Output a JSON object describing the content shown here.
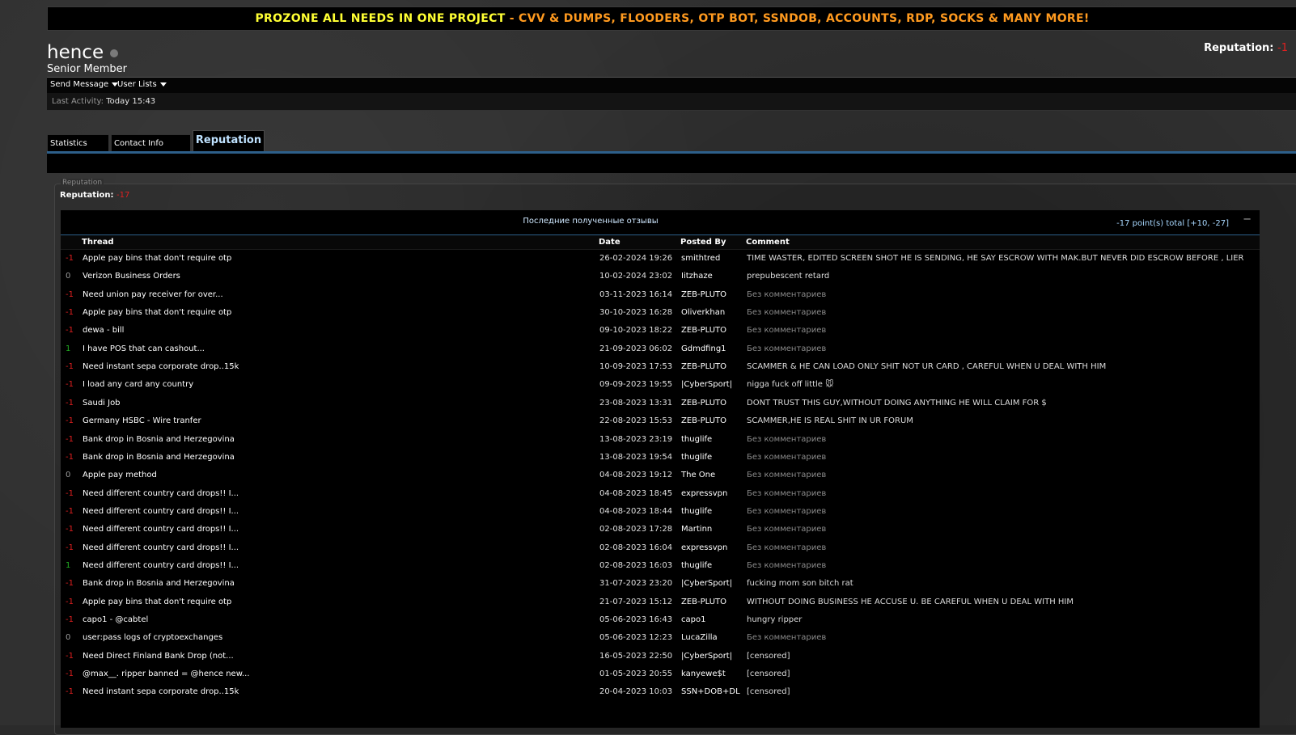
{
  "banner": {
    "part1": "PROZONE ALL NEEDS IN ONE PROJECT",
    "sep": " - ",
    "part2": "CVV & DUMPS, FLOODERS, OTP BOT, SSNDOB, ACCOUNTS, RDP, SOCKS & MANY MORE!",
    "color_primary": "#ffff33",
    "color_secondary": "#ff9a1f"
  },
  "profile": {
    "username": "hence",
    "title": "Senior Member",
    "status_icon": "offline-dot-icon",
    "reputation_label": "Reputation:",
    "reputation_value": "-1"
  },
  "actions": {
    "send_message": "Send Message",
    "user_lists": "User Lists"
  },
  "activity": {
    "label": "Last Activity:",
    "value": "Today 15:43"
  },
  "tabs": [
    {
      "label": "Statistics"
    },
    {
      "label": "Contact Info"
    },
    {
      "label": "Reputation"
    }
  ],
  "reputation_section": {
    "legend": "Reputation",
    "label": "Reputation:",
    "value": "-17"
  },
  "feed": {
    "title": "Последние полученные отзывы",
    "total": "-17 point(s) total [+10, -27]",
    "collapse": "−",
    "headers": {
      "thread": "Thread",
      "date": "Date",
      "posted_by": "Posted By",
      "comment": "Comment"
    },
    "rows": [
      {
        "pts": "-1",
        "thread": "Apple pay bins that don't require otp",
        "date": "26-02-2024 19:26",
        "by": "smithtred",
        "comment": "TIME WASTER, EDITED SCREEN SHOT HE IS SENDING, HE SAY ESCROW WITH MAK.BUT NEVER DID ESCROW BEFORE , LIER"
      },
      {
        "pts": "0",
        "thread": "Verizon Business Orders",
        "date": "10-02-2024 23:02",
        "by": "Iitzhaze",
        "comment": "prepubescent retard"
      },
      {
        "pts": "-1",
        "thread": "Need union pay receiver for over...",
        "date": "03-11-2023 16:14",
        "by": "ZEB-PLUTO",
        "comment": "Без комментариев"
      },
      {
        "pts": "-1",
        "thread": "Apple pay bins that don't require otp",
        "date": "30-10-2023 16:28",
        "by": "Oliverkhan",
        "comment": "Без комментариев"
      },
      {
        "pts": "-1",
        "thread": "dewa - bill",
        "date": "09-10-2023 18:22",
        "by": "ZEB-PLUTO",
        "comment": "Без комментариев"
      },
      {
        "pts": "1",
        "thread": "I have POS that can cashout...",
        "date": "21-09-2023 06:02",
        "by": "Gdmdfing1",
        "comment": "Без комментариев"
      },
      {
        "pts": "-1",
        "thread": "Need instant sepa corporate drop..15k",
        "date": "10-09-2023 17:53",
        "by": "ZEB-PLUTO",
        "comment": "SCAMMER & HE CAN LOAD ONLY SHIT NOT UR CARD , CAREFUL WHEN U DEAL WITH HIM"
      },
      {
        "pts": "-1",
        "thread": "I load any card any country",
        "date": "09-09-2023 19:55",
        "by": "|CyberSport|",
        "comment": "nigga fuck off little 🐭"
      },
      {
        "pts": "-1",
        "thread": "Saudi Job",
        "date": "23-08-2023 13:31",
        "by": "ZEB-PLUTO",
        "comment": "DONT TRUST THIS GUY,WITHOUT DOING ANYTHING HE WILL CLAIM FOR $"
      },
      {
        "pts": "-1",
        "thread": "Germany HSBC - Wire tranfer",
        "date": "22-08-2023 15:53",
        "by": "ZEB-PLUTO",
        "comment": "SCAMMER,HE IS REAL SHIT IN UR FORUM"
      },
      {
        "pts": "-1",
        "thread": "Bank drop in Bosnia and Herzegovina",
        "date": "13-08-2023 23:19",
        "by": "thuglife",
        "comment": "Без комментариев"
      },
      {
        "pts": "-1",
        "thread": "Bank drop in Bosnia and Herzegovina",
        "date": "13-08-2023 19:54",
        "by": "thuglife",
        "comment": "Без комментариев"
      },
      {
        "pts": "0",
        "thread": "Apple pay method",
        "date": "04-08-2023 19:12",
        "by": "The One",
        "comment": "Без комментариев"
      },
      {
        "pts": "-1",
        "thread": "Need different country card drops!! I...",
        "date": "04-08-2023 18:45",
        "by": "expressvpn",
        "comment": "Без комментариев"
      },
      {
        "pts": "-1",
        "thread": "Need different country card drops!! I...",
        "date": "04-08-2023 18:44",
        "by": "thuglife",
        "comment": "Без комментариев"
      },
      {
        "pts": "-1",
        "thread": "Need different country card drops!! I...",
        "date": "02-08-2023 17:28",
        "by": "Martinn",
        "comment": "Без комментариев"
      },
      {
        "pts": "-1",
        "thread": "Need different country card drops!! I...",
        "date": "02-08-2023 16:04",
        "by": "expressvpn",
        "comment": "Без комментариев"
      },
      {
        "pts": "1",
        "thread": "Need different country card drops!! I...",
        "date": "02-08-2023 16:03",
        "by": "thuglife",
        "comment": "Без комментариев"
      },
      {
        "pts": "-1",
        "thread": "Bank drop in Bosnia and Herzegovina",
        "date": "31-07-2023 23:20",
        "by": "|CyberSport|",
        "comment": "fucking mom son bitch rat"
      },
      {
        "pts": "-1",
        "thread": "Apple pay bins that don't require otp",
        "date": "21-07-2023 15:12",
        "by": "ZEB-PLUTO",
        "comment": "WITHOUT DOING BUSINESS HE ACCUSE U. BE CAREFUL WHEN U DEAL WITH HIM"
      },
      {
        "pts": "-1",
        "thread": "capo1 - @cabtel",
        "date": "05-06-2023 16:43",
        "by": "capo1",
        "comment": "hungry ripper"
      },
      {
        "pts": "0",
        "thread": "user:pass logs of cryptoexchanges",
        "date": "05-06-2023 12:23",
        "by": "LucaZilla",
        "comment": "Без комментариев"
      },
      {
        "pts": "-1",
        "thread": "Need Direct Finland Bank Drop (not...",
        "date": "16-05-2023 22:50",
        "by": "|CyberSport|",
        "comment": "[censored]"
      },
      {
        "pts": "-1",
        "thread": "@max__. ripper banned = @hence new...",
        "date": "01-05-2023 20:55",
        "by": "kanyewe$t",
        "comment": "[censored]"
      },
      {
        "pts": "-1",
        "thread": "Need instant sepa corporate drop..15k",
        "date": "20-04-2023 10:03",
        "by": "SSN+DOB+DL",
        "comment": "[censored]"
      }
    ]
  }
}
